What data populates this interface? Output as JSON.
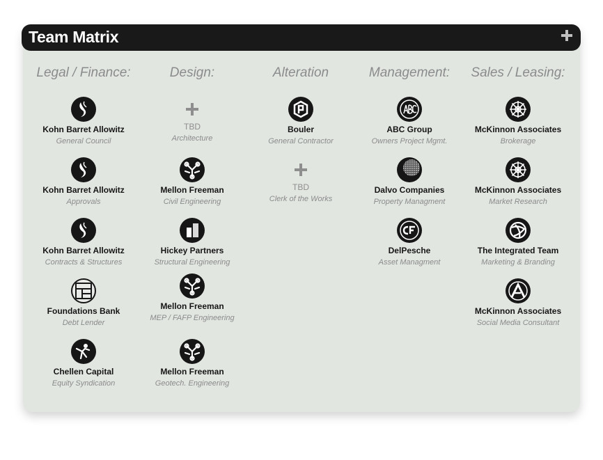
{
  "header": {
    "title": "Team Matrix"
  },
  "columns": [
    {
      "label": "Legal / Finance:",
      "cards": [
        {
          "name": "Kohn Barret Allowitz",
          "role": "General Council",
          "icon": "kohn-logo-icon"
        },
        {
          "name": "Kohn Barret Allowitz",
          "role": "Approvals",
          "icon": "kohn-logo-icon"
        },
        {
          "name": "Kohn Barret Allowitz",
          "role": "Contracts & Structures",
          "icon": "kohn-logo-icon"
        },
        {
          "name": "Foundations Bank",
          "role": "Debt Lender",
          "icon": "foundations-logo-icon"
        },
        {
          "name": "Chellen Capital",
          "role": "Equity Syndication",
          "icon": "chellen-logo-icon"
        }
      ]
    },
    {
      "label": "Design:",
      "cards": [
        {
          "name": "TBD",
          "role": "Architecture",
          "icon": "add-icon"
        },
        {
          "name": "Mellon Freeman",
          "role": "Civil Engineering",
          "icon": "mellon-logo-icon"
        },
        {
          "name": "Hickey Partners",
          "role": "Structural Engineering",
          "icon": "hickey-logo-icon"
        },
        {
          "name": "Mellon Freeman",
          "role": "MEP / FAFP Engineering",
          "icon": "mellon-logo-icon"
        },
        {
          "name": "Mellon Freeman",
          "role": "Geotech. Engineering",
          "icon": "mellon-logo-icon"
        }
      ]
    },
    {
      "label": "Alteration",
      "cards": [
        {
          "name": "Bouler",
          "role": "General Contractor",
          "icon": "bouler-logo-icon"
        },
        {
          "name": "TBD",
          "role": "Clerk of the Works",
          "icon": "add-icon"
        }
      ]
    },
    {
      "label": "Management:",
      "cards": [
        {
          "name": "ABC Group",
          "role": "Owners Project Mgmt.",
          "icon": "abc-logo-icon"
        },
        {
          "name": "Dalvo Companies",
          "role": "Property Managment",
          "icon": "dalvo-logo-icon"
        },
        {
          "name": "DelPesche",
          "role": "Asset Managment",
          "icon": "delpesche-logo-icon"
        }
      ]
    },
    {
      "label": "Sales / Leasing:",
      "cards": [
        {
          "name": "McKinnon Associates",
          "role": "Brokerage",
          "icon": "mckinnon-logo-icon"
        },
        {
          "name": "McKinnon Associates",
          "role": "Market Research",
          "icon": "mckinnon-logo-icon"
        },
        {
          "name": "The Integrated Team",
          "role": "Marketing & Branding",
          "icon": "integrated-logo-icon"
        },
        {
          "name": "McKinnon Associates",
          "role": "Social Media Consultant",
          "icon": "social-logo-icon"
        }
      ]
    }
  ]
}
